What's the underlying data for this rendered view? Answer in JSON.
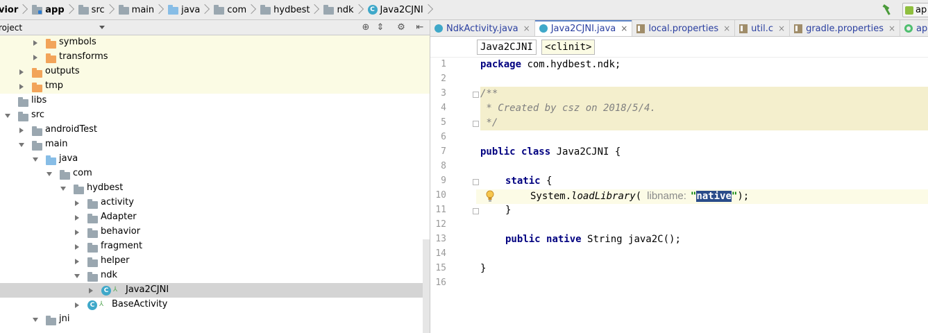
{
  "breadcrumb": {
    "items": [
      {
        "label": "vior",
        "icon": "none"
      },
      {
        "label": "app",
        "icon": "module-folder-icon"
      },
      {
        "label": "src",
        "icon": "folder-icon"
      },
      {
        "label": "main",
        "icon": "folder-icon"
      },
      {
        "label": "java",
        "icon": "source-folder-icon"
      },
      {
        "label": "com",
        "icon": "package-icon"
      },
      {
        "label": "hydbest",
        "icon": "package-icon"
      },
      {
        "label": "ndk",
        "icon": "package-icon"
      },
      {
        "label": "Java2CJNI",
        "icon": "class-icon"
      }
    ],
    "class_icon_letter": "C"
  },
  "run_config": {
    "label": "ap"
  },
  "project_panel": {
    "title": "roject",
    "tree": [
      {
        "label": "symbols",
        "depth": 2,
        "expanded": false,
        "kind": "folder-orange",
        "generated": true,
        "selected": false
      },
      {
        "label": "transforms",
        "depth": 2,
        "expanded": false,
        "kind": "folder-orange",
        "generated": true,
        "selected": false
      },
      {
        "label": "outputs",
        "depth": 1,
        "expanded": false,
        "kind": "folder-orange",
        "generated": true,
        "selected": false
      },
      {
        "label": "tmp",
        "depth": 1,
        "expanded": false,
        "kind": "folder-orange",
        "generated": true,
        "selected": false
      },
      {
        "label": "libs",
        "depth": 0,
        "expanded": null,
        "kind": "folder",
        "generated": false,
        "selected": false
      },
      {
        "label": "src",
        "depth": 0,
        "expanded": true,
        "kind": "folder",
        "generated": false,
        "selected": false
      },
      {
        "label": "androidTest",
        "depth": 1,
        "expanded": false,
        "kind": "folder",
        "generated": false,
        "selected": false
      },
      {
        "label": "main",
        "depth": 1,
        "expanded": true,
        "kind": "folder",
        "generated": false,
        "selected": false
      },
      {
        "label": "java",
        "depth": 2,
        "expanded": true,
        "kind": "folder-blue",
        "generated": false,
        "selected": false
      },
      {
        "label": "com",
        "depth": 3,
        "expanded": true,
        "kind": "package",
        "generated": false,
        "selected": false
      },
      {
        "label": "hydbest",
        "depth": 4,
        "expanded": true,
        "kind": "package",
        "generated": false,
        "selected": false
      },
      {
        "label": "activity",
        "depth": 5,
        "expanded": false,
        "kind": "package",
        "generated": false,
        "selected": false
      },
      {
        "label": "Adapter",
        "depth": 5,
        "expanded": false,
        "kind": "package",
        "generated": false,
        "selected": false
      },
      {
        "label": "behavior",
        "depth": 5,
        "expanded": false,
        "kind": "package",
        "generated": false,
        "selected": false
      },
      {
        "label": "fragment",
        "depth": 5,
        "expanded": false,
        "kind": "package",
        "generated": false,
        "selected": false
      },
      {
        "label": "helper",
        "depth": 5,
        "expanded": false,
        "kind": "package",
        "generated": false,
        "selected": false
      },
      {
        "label": "ndk",
        "depth": 5,
        "expanded": true,
        "kind": "package",
        "generated": false,
        "selected": false
      },
      {
        "label": "Java2CJNI",
        "depth": 6,
        "expanded": false,
        "kind": "class",
        "generated": false,
        "selected": true
      },
      {
        "label": "BaseActivity",
        "depth": 5,
        "expanded": false,
        "kind": "class",
        "generated": false,
        "selected": false
      },
      {
        "label": "jni",
        "depth": 2,
        "expanded": true,
        "kind": "folder",
        "generated": false,
        "selected": false
      }
    ]
  },
  "tabs": [
    {
      "label": "NdkActivity.java",
      "icon": "class-icon",
      "active": false
    },
    {
      "label": "Java2CJNI.java",
      "icon": "class-icon",
      "active": true
    },
    {
      "label": "local.properties",
      "icon": "properties-icon",
      "active": false
    },
    {
      "label": "util.c",
      "icon": "properties-icon",
      "active": false
    },
    {
      "label": "gradle.properties",
      "icon": "properties-icon",
      "active": false
    },
    {
      "label": "app",
      "icon": "module-icon",
      "active": false
    }
  ],
  "tab_close_glyph": "×",
  "editor_breadcrumb": [
    "Java2CJNI",
    "<clinit>"
  ],
  "code": {
    "line_numbers": [
      "1",
      "2",
      "3",
      "4",
      "5",
      "6",
      "7",
      "8",
      "9",
      "10",
      "11",
      "12",
      "13",
      "14",
      "15",
      "16"
    ],
    "line1_kw": "package",
    "line1_rest": " com.hydbest.ndk;",
    "line3": "/**",
    "line4": " * Created by csz on 2018/5/4.",
    "line5": " */",
    "line7_kw1": "public",
    "line7_kw2": "class",
    "line7_rest": " Java2CJNI {",
    "line9_kw": "static",
    "line9_rest": " {",
    "line10_pre": "System.",
    "line10_method": "loadLibrary",
    "line10_paren": "(",
    "line10_hint": "libname:",
    "line10_q1": "\"",
    "line10_str": "native",
    "line10_q2": "\"",
    "line10_end": ");",
    "line11": "}",
    "line13_kw1": "public",
    "line13_kw2": "native",
    "line13_rest": " String java2C();",
    "line15": "}"
  }
}
